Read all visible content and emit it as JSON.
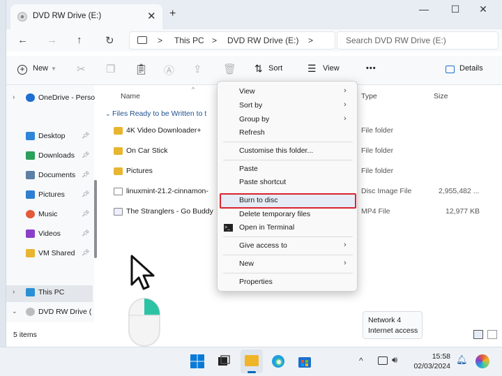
{
  "tab": {
    "title": "DVD RW Drive (E:)",
    "close": "✕",
    "new": "+"
  },
  "window_controls": {
    "minimize": "—",
    "maximize": "☐",
    "close": "✕"
  },
  "nav": {
    "back": "←",
    "forward": "→",
    "up": "↑",
    "refresh": "↻"
  },
  "address": {
    "sep": ">",
    "crumbs": [
      "This PC",
      "DVD RW Drive (E:)"
    ]
  },
  "search": {
    "placeholder": "Search DVD RW Drive (E:)"
  },
  "toolbar": {
    "new_label": "New",
    "sort_label": "Sort",
    "view_label": "View",
    "more": "•••",
    "details_label": "Details"
  },
  "sidebar": {
    "items": [
      {
        "label": "OneDrive - Perso",
        "color": "#1f6fd1"
      },
      {
        "label": "Desktop",
        "color": "#2f86d8"
      },
      {
        "label": "Downloads",
        "color": "#2aa05a"
      },
      {
        "label": "Documents",
        "color": "#5b7fa6"
      },
      {
        "label": "Pictures",
        "color": "#2f7fd0"
      },
      {
        "label": "Music",
        "color": "#e35a3a"
      },
      {
        "label": "Videos",
        "color": "#8a3fc9"
      },
      {
        "label": "VM Shared",
        "color": "#e8b530"
      },
      {
        "label": "This PC",
        "color": "#2b8fd6"
      },
      {
        "label": "DVD RW Drive (",
        "color": "#bdbdbd"
      }
    ]
  },
  "columns": {
    "name": "Name",
    "type": "Type",
    "size": "Size"
  },
  "group_label": "Files Ready to be Written to t",
  "files": [
    {
      "name": "4K Video Downloader+",
      "type": "File folder",
      "size": ""
    },
    {
      "name": "On Car Stick",
      "type": "File folder",
      "size": ""
    },
    {
      "name": "Pictures",
      "type": "File folder",
      "size": ""
    },
    {
      "name": "linuxmint-21.2-cinnamon-",
      "type": "Disc Image File",
      "size": "2,955,482 ..."
    },
    {
      "name": "The Stranglers - Go Buddy",
      "type": "MP4 File",
      "size": "12,977 KB"
    }
  ],
  "status": {
    "count": "5 items"
  },
  "context_menu": {
    "view": "View",
    "sort_by": "Sort by",
    "group_by": "Group by",
    "refresh": "Refresh",
    "customise": "Customise this folder...",
    "paste": "Paste",
    "paste_shortcut": "Paste shortcut",
    "burn": "Burn to disc",
    "delete_temp": "Delete temporary files",
    "terminal": "Open in Terminal",
    "give_access": "Give access to",
    "new": "New",
    "properties": "Properties"
  },
  "tooltip": {
    "line1": "Network 4",
    "line2": "Internet access"
  },
  "clock": {
    "time": "15:58",
    "date": "02/03/2024"
  },
  "accent": "#0067c0",
  "highlight_color": "#d9232e"
}
